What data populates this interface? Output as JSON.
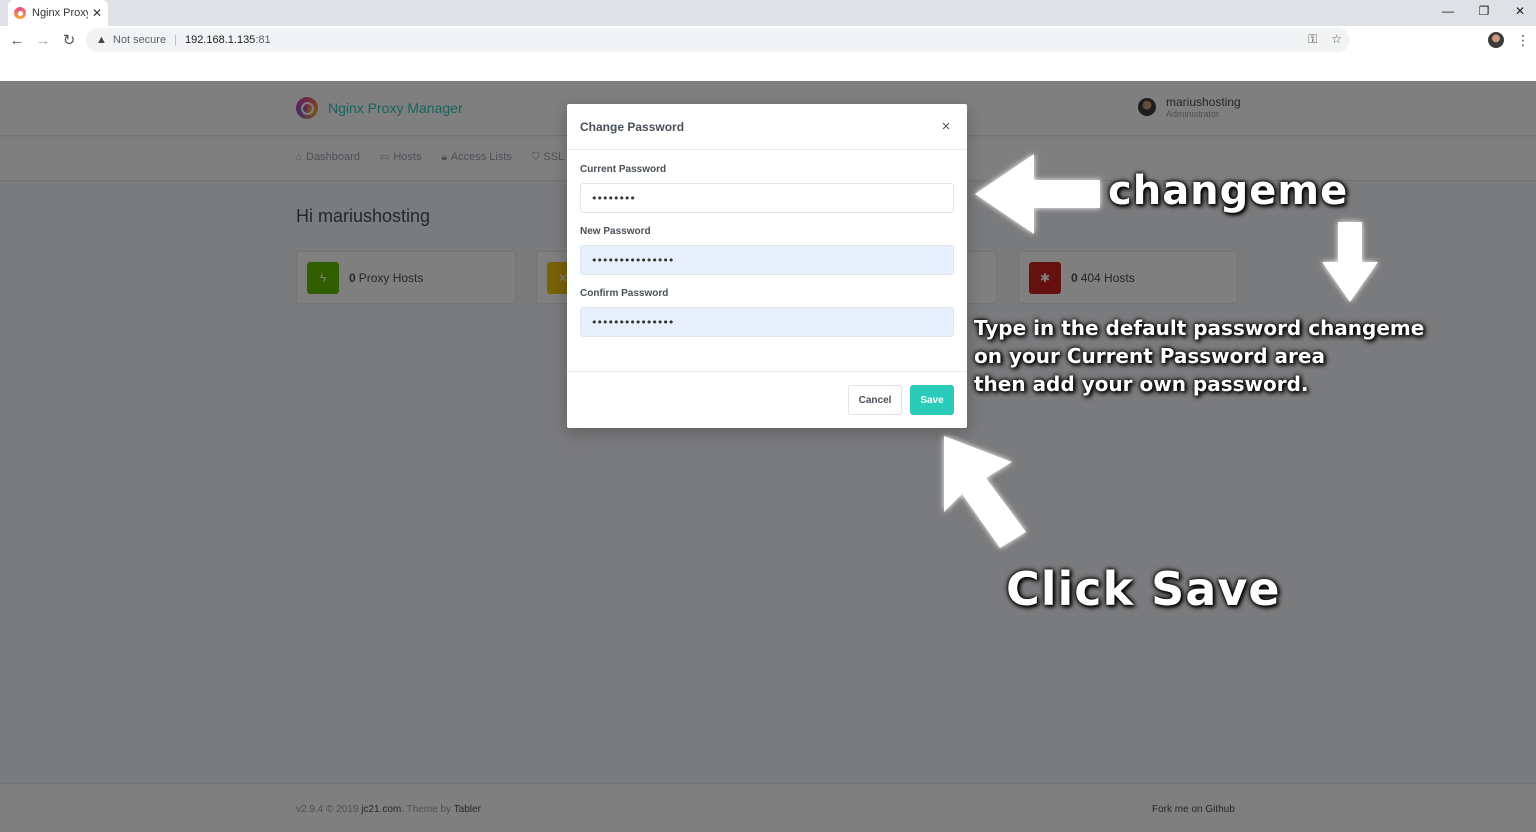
{
  "browser": {
    "tab_title": "Nginx Proxy",
    "tab_close": "✕",
    "security_label": "Not secure",
    "url_host": "192.168.1.135",
    "url_port": ":81",
    "window_minimize": "—",
    "window_restore": "❐",
    "window_close": "✕"
  },
  "header": {
    "brand": "Nginx Proxy Manager",
    "user_name": "mariushosting",
    "user_role": "Administrator"
  },
  "nav": {
    "items": [
      {
        "label": "Dashboard",
        "icon": "home-icon"
      },
      {
        "label": "Hosts",
        "icon": "monitor-icon"
      },
      {
        "label": "Access Lists",
        "icon": "lock-icon"
      },
      {
        "label": "SSL",
        "icon": "shield-icon"
      }
    ]
  },
  "dashboard": {
    "greeting": "Hi mariushosting",
    "cards": [
      {
        "count": "0",
        "label": "Proxy Hosts",
        "color": "#5eba00",
        "icon": "bolt-icon"
      },
      {
        "count": "",
        "label": "",
        "color": "#f1c40f",
        "icon": "shuffle-icon"
      },
      {
        "count": "0",
        "label": "404 Hosts",
        "color": "#cd201f",
        "icon": "zap-off-icon"
      }
    ]
  },
  "footer": {
    "version": "v2.9.4 © 2019",
    "author_link": "jc21.com",
    "theme_text": ". Theme by",
    "theme_link": "Tabler",
    "github": "Fork me on Github"
  },
  "modal": {
    "title": "Change Password",
    "close": "×",
    "fields": [
      {
        "label": "Current Password",
        "value": "••••••••"
      },
      {
        "label": "New Password",
        "value": "•••••••••••••••"
      },
      {
        "label": "Confirm Password",
        "value": "•••••••••••••••"
      }
    ],
    "cancel_label": "Cancel",
    "save_label": "Save"
  },
  "annotations": {
    "changeme": "changeme",
    "instruction_lines": [
      "Type in the default password changeme",
      "on your Current Password area",
      "then add your own password."
    ],
    "click_save": "Click Save"
  },
  "colors": {
    "accent": "#2bcbba",
    "input_autofill": "#e8f0fe"
  }
}
